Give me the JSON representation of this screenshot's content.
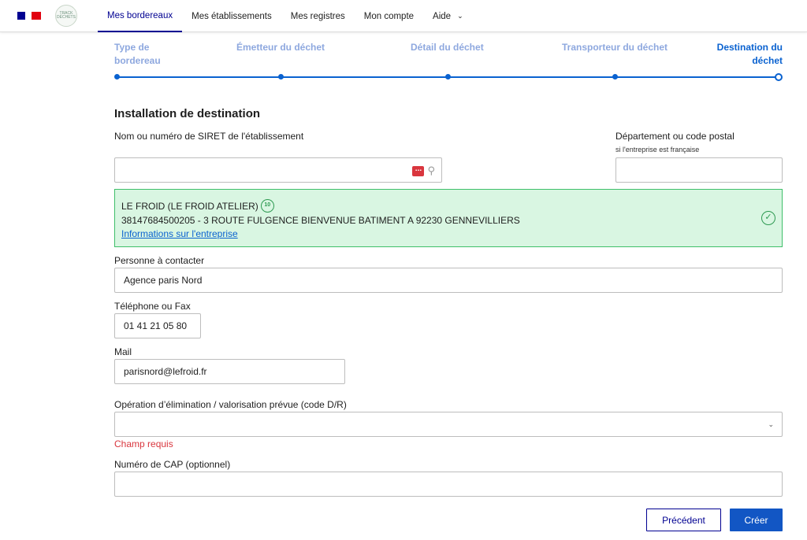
{
  "header": {
    "logo_text": "TRACK DÉCHETS",
    "nav": [
      {
        "label": "Mes bordereaux",
        "active": true
      },
      {
        "label": "Mes établissements"
      },
      {
        "label": "Mes registres"
      },
      {
        "label": "Mon compte"
      },
      {
        "label": "Aide",
        "has_dropdown": true
      }
    ]
  },
  "stepper": {
    "steps": [
      "Type de bordereau",
      "Émetteur du déchet",
      "Détail du déchet",
      "Transporteur du déchet",
      "Destination du déchet"
    ],
    "current_index": 4
  },
  "form": {
    "section_title": "Installation de destination",
    "siret_label": "Nom ou numéro de SIRET de l'établissement",
    "siret_value": "",
    "dept_label": "Département ou code postal",
    "dept_hint": "si l'entreprise est française",
    "dept_value": "",
    "company": {
      "name": "LE FROID (LE FROID ATELIER)",
      "address": "38147684500205 - 3 ROUTE FULGENCE BIENVENUE BATIMENT A 92230 GENNEVILLIERS",
      "link": "Informations sur l'entreprise",
      "badge_icon": "verified-badge-icon",
      "check_icon": "check-circle-icon"
    },
    "contact_label": "Personne à contacter",
    "contact_value": "Agence paris Nord",
    "phone_label": "Téléphone ou Fax",
    "phone_value": "01 41 21 05 80",
    "mail_label": "Mail",
    "mail_value": "parisnord@lefroid.fr",
    "operation_label": "Opération d’élimination / valorisation prévue (code D/R)",
    "operation_value": "",
    "operation_error": "Champ requis",
    "cap_label": "Numéro de CAP (optionnel)",
    "cap_value": ""
  },
  "buttons": {
    "previous": "Précédent",
    "create": "Créer"
  },
  "colors": {
    "primary": "#000091",
    "accent": "#0a62d0",
    "success_bg": "#d9f6e2",
    "success_border": "#3fbf6a",
    "error": "#d9363e"
  }
}
